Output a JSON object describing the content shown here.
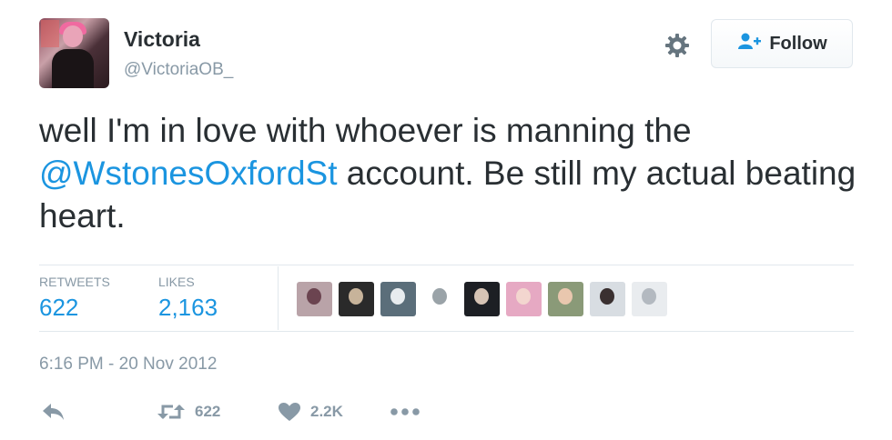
{
  "user": {
    "display_name": "Victoria",
    "handle": "@VictoriaOB_"
  },
  "header": {
    "follow_label": "Follow",
    "gear_icon": "gear-icon"
  },
  "tweet": {
    "text_before": "well I'm in love with whoever is manning the",
    "mention": "@WstonesOxfordSt",
    "text_after": " account. Be still my actual beating heart."
  },
  "stats": {
    "retweets_label": "RETWEETS",
    "retweets_value": "622",
    "likes_label": "LIKES",
    "likes_value": "2,163"
  },
  "likers": [
    {
      "name": "liker-avatar-1",
      "bg": "#b9a3a8",
      "fg": "#6b4450"
    },
    {
      "name": "liker-avatar-2",
      "bg": "#2a2a2a",
      "fg": "#c7b39a"
    },
    {
      "name": "liker-avatar-3",
      "bg": "#5b6e7a",
      "fg": "#e8ecef"
    },
    {
      "name": "liker-avatar-4",
      "bg": "#ffffff",
      "fg": "#9aa3a8"
    },
    {
      "name": "liker-avatar-5",
      "bg": "#1d1f24",
      "fg": "#d7c4b5"
    },
    {
      "name": "liker-avatar-6",
      "bg": "#e6a9c3",
      "fg": "#f3d6cf"
    },
    {
      "name": "liker-avatar-7",
      "bg": "#8a9a78",
      "fg": "#e9c7ae"
    },
    {
      "name": "liker-avatar-8",
      "bg": "#d8dde2",
      "fg": "#3a3030"
    },
    {
      "name": "liker-avatar-9",
      "bg": "#e9ecef",
      "fg": "#b3b9c0"
    }
  ],
  "timestamp": "6:16 PM - 20 Nov 2012",
  "actions": {
    "reply_icon": "reply-icon",
    "retweet_icon": "retweet-icon",
    "retweet_count": "622",
    "like_icon": "heart-icon",
    "like_count": "2.2K",
    "more_icon": "more-icon"
  },
  "colors": {
    "link": "#1b95e0",
    "muted": "#8899a6",
    "text": "#292f33"
  }
}
